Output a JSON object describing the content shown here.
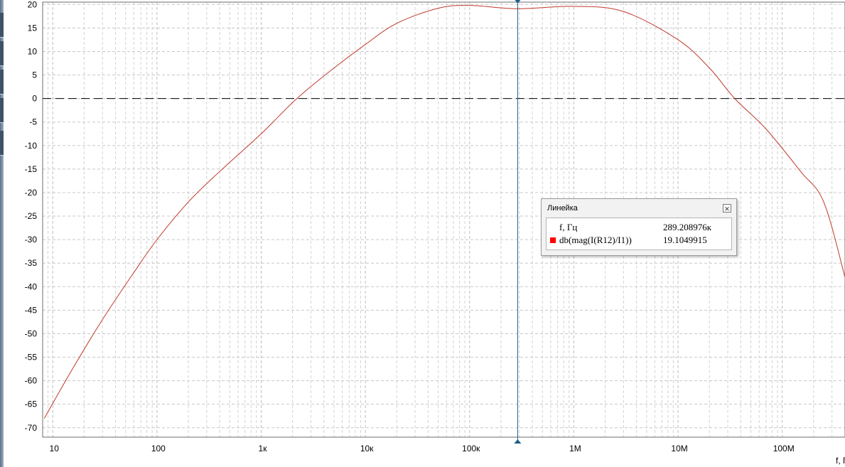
{
  "ruler": {
    "title": "Линейка",
    "close_icon": "close-icon",
    "rows": [
      {
        "name": "f, Гц",
        "value": "289.208976к",
        "color": ""
      },
      {
        "name": "db(mag(I(R12)/I1))",
        "value": "19.1049915",
        "color": "#ff0000"
      }
    ]
  },
  "chart_data": {
    "type": "line",
    "x_scale": "log",
    "xlim": [
      8,
      400000000
    ],
    "ylim": [
      -72,
      20.5
    ],
    "xlabel": "f, Г",
    "ylabel": "",
    "title": "",
    "grid": true,
    "x_ticks": [
      {
        "value": 10,
        "label": "10"
      },
      {
        "value": 100,
        "label": "100"
      },
      {
        "value": 1000,
        "label": "1к"
      },
      {
        "value": 10000,
        "label": "10к"
      },
      {
        "value": 100000,
        "label": "100к"
      },
      {
        "value": 1000000,
        "label": "1M"
      },
      {
        "value": 10000000,
        "label": "10M"
      },
      {
        "value": 100000000,
        "label": "100M"
      }
    ],
    "y_ticks": [
      20,
      15,
      10,
      5,
      0,
      -5,
      -10,
      -15,
      -20,
      -25,
      -30,
      -35,
      -40,
      -45,
      -50,
      -55,
      -60,
      -65,
      -70
    ],
    "reference_line": {
      "y": 0,
      "style": "dashed",
      "color": "#000000"
    },
    "cursor": {
      "x": 289208.976,
      "color": "#1f5f8b"
    },
    "series": [
      {
        "name": "db(mag(I(R12)/I1))",
        "color": "#c0392b",
        "x": [
          8.3,
          15,
          30,
          60,
          100,
          200,
          400,
          1000,
          2200,
          5000,
          10000,
          20000,
          50000,
          100000,
          289209,
          1000000,
          3000000,
          10000000,
          20000000,
          35000000,
          70000000,
          150000000,
          250000000,
          400000000
        ],
        "y": [
          -68,
          -58,
          -47,
          -37,
          -30,
          -22,
          -15.5,
          -7.5,
          0,
          6.5,
          11.5,
          16,
          19.2,
          19.8,
          19.1,
          19.6,
          18.5,
          12.5,
          6.5,
          0,
          -6.5,
          -15.5,
          -22,
          -38
        ]
      }
    ]
  }
}
